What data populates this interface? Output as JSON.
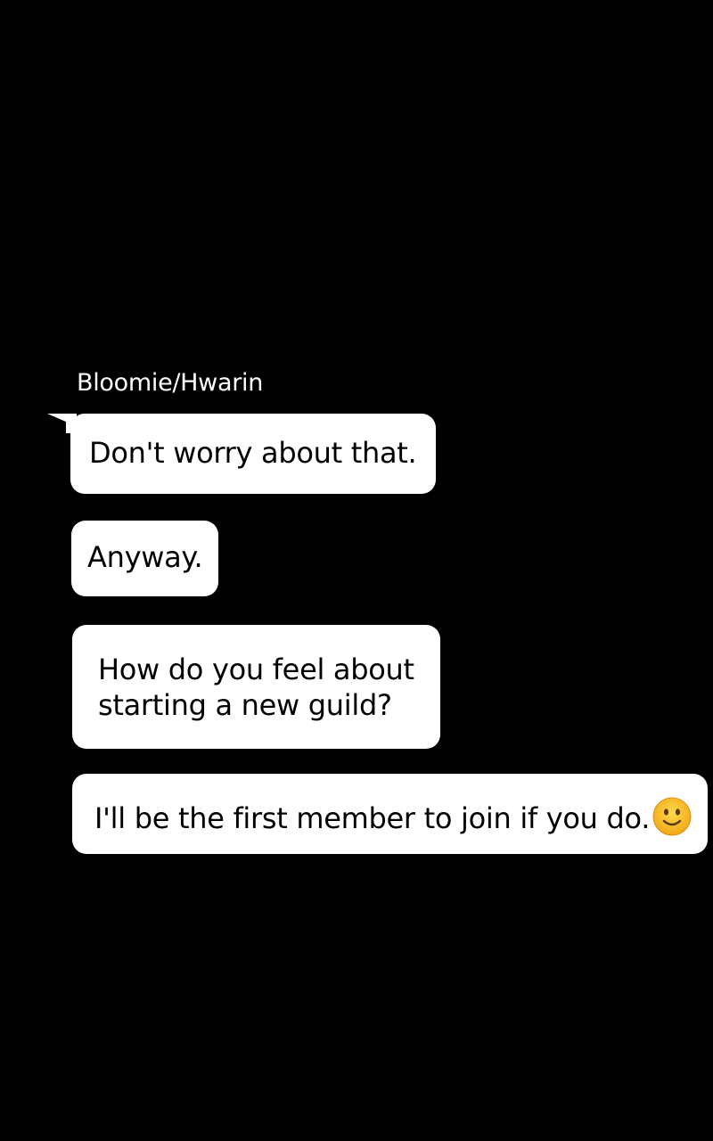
{
  "chat": {
    "sender_name": "Bloomie/Hwarin",
    "messages": [
      {
        "text": "Don't worry about that."
      },
      {
        "text": "Anyway."
      },
      {
        "lines": [
          "How do you feel about",
          "starting a new guild?"
        ]
      },
      {
        "text": "I'll be the first member to join if you do.",
        "trailing_icon": "slightly-smiling-face-emoji"
      }
    ]
  },
  "colors": {
    "background": "#000000",
    "bubble": "#ffffff",
    "text_on_bubble": "#000000",
    "sender_text": "#ffffff",
    "emoji_face": "#f5b91e"
  }
}
